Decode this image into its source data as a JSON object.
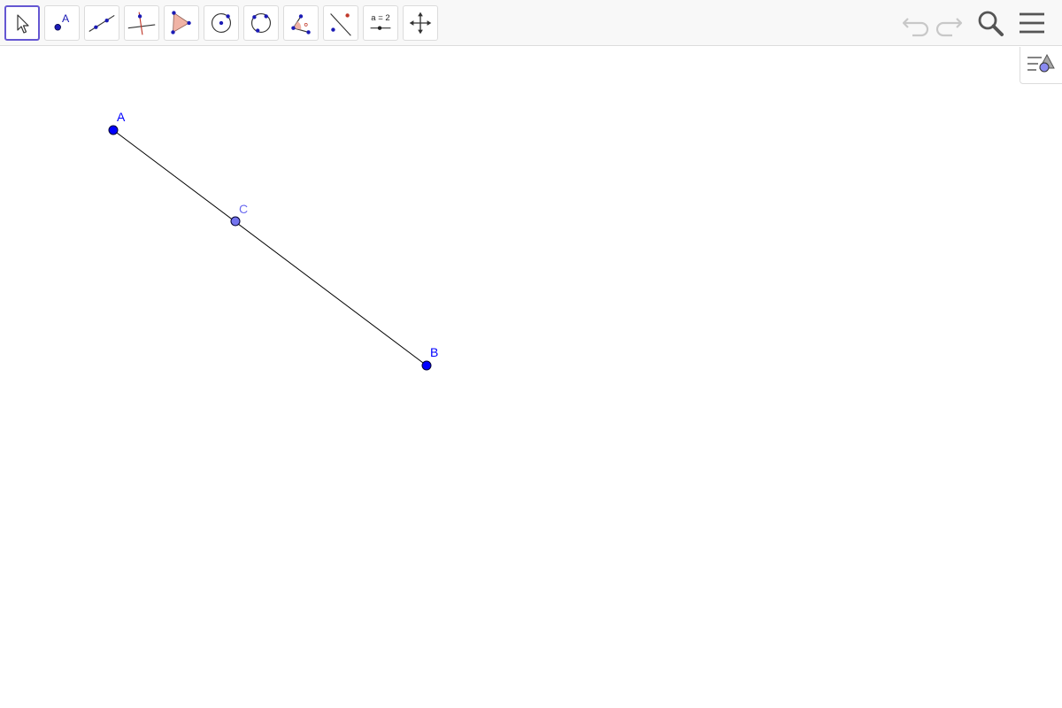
{
  "toolbar": {
    "tools": [
      {
        "name": "move-tool",
        "icon": "arrow-pointer-icon",
        "selected": true
      },
      {
        "name": "point-tool",
        "icon": "point-icon",
        "label": "A"
      },
      {
        "name": "line-tool",
        "icon": "line-through-two-points-icon"
      },
      {
        "name": "perpendicular-line-tool",
        "icon": "perpendicular-line-icon"
      },
      {
        "name": "polygon-tool",
        "icon": "polygon-icon"
      },
      {
        "name": "circle-center-point-tool",
        "icon": "circle-center-point-icon"
      },
      {
        "name": "circle-three-points-tool",
        "icon": "circle-three-points-icon"
      },
      {
        "name": "angle-tool",
        "icon": "angle-icon"
      },
      {
        "name": "reflect-about-line-tool",
        "icon": "reflect-about-line-icon"
      },
      {
        "name": "slider-tool",
        "icon": "slider-icon",
        "label": "a = 2"
      },
      {
        "name": "move-graphics-view-tool",
        "icon": "move-graphics-view-icon"
      }
    ],
    "right_icons": [
      "undo-icon",
      "redo-icon",
      "search-icon",
      "menu-icon"
    ]
  },
  "style_bar_toggle": {
    "icon": "style-bar-icon"
  },
  "construction": {
    "colors": {
      "point": "#0000ff",
      "point_outline": "#000033",
      "point_on_path": "#7474ee",
      "label": "#0000ff",
      "label_on_path": "#6b6bf0",
      "segment": "#000000",
      "selection": "#6557d2"
    },
    "points": [
      {
        "label": "A",
        "type": "free"
      },
      {
        "label": "B",
        "type": "free"
      },
      {
        "label": "C",
        "type": "point-on-segment"
      }
    ],
    "segments": [
      {
        "from": "A",
        "to": "B"
      }
    ]
  }
}
